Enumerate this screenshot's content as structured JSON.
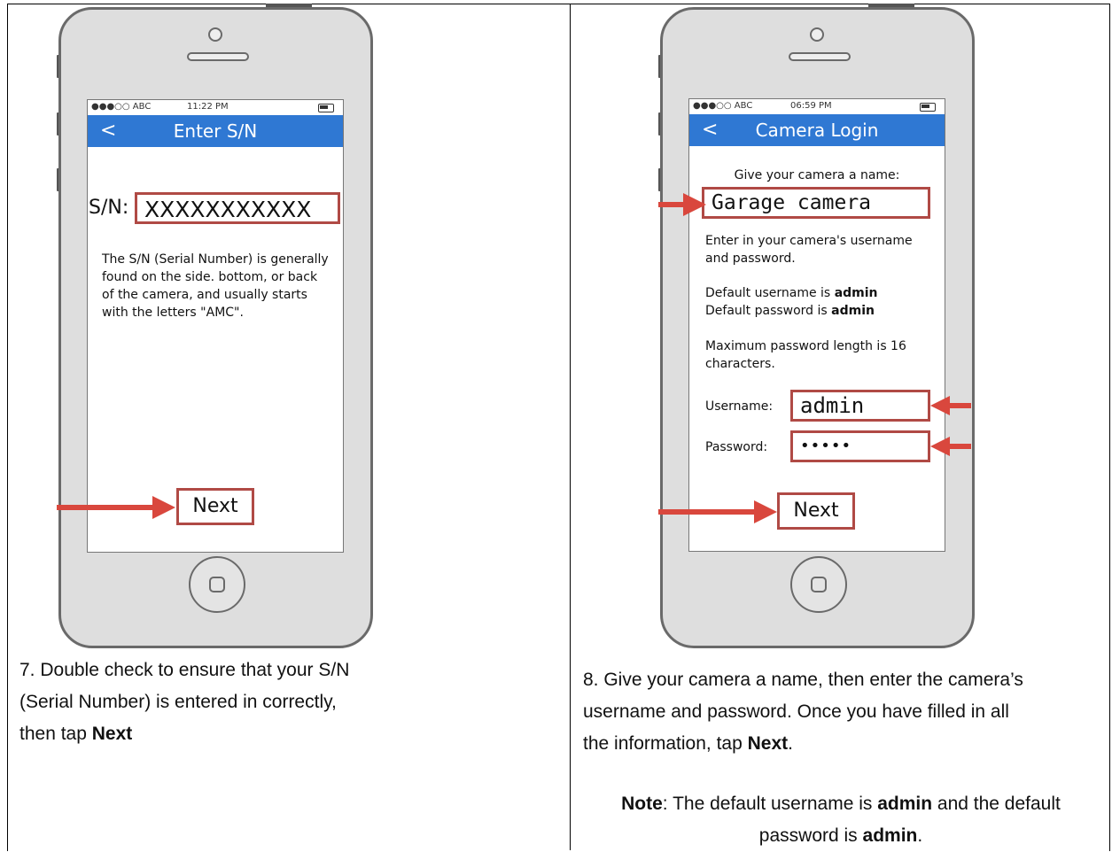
{
  "left": {
    "status": {
      "carrier": "●●●○○ ABC",
      "time": "11:22 PM"
    },
    "nav": {
      "back": "<",
      "title": "Enter S/N"
    },
    "sn_label": "S/N:",
    "sn_value": "XXXXXXXXXXX",
    "description": "The S/N (Serial Number) is generally found on the side. bottom, or back of the camera, and usually starts with the letters \"AMC\".",
    "next_label": "Next",
    "caption": {
      "line1": "7. Double check to ensure that your S/N",
      "line2": "(Serial Number) is entered in correctly,",
      "line3_pre": "then tap ",
      "line3_bold": "Next"
    }
  },
  "right": {
    "status": {
      "carrier": "●●●○○ ABC",
      "time": "06:59 PM"
    },
    "nav": {
      "back": "<",
      "title": "Camera Login"
    },
    "name_prompt": "Give your camera a name:",
    "name_value": "Garage camera",
    "enter_text": "Enter in your camera's username and password.",
    "default_user_pre": "Default username is ",
    "default_user_bold": "admin",
    "default_pass_pre": "Default password is ",
    "default_pass_bold": "admin",
    "max_text": "Maximum password length is 16 characters.",
    "username_label": "Username:",
    "username_value": "admin",
    "password_label": "Password:",
    "password_value": "•••••",
    "next_label": "Next",
    "caption": {
      "line1": "8. Give your camera a name, then enter the camera’s",
      "line2": "username and password. Once you have filled in all",
      "line3_pre": "the information, tap ",
      "line3_bold": "Next",
      "line3_post": "."
    },
    "note": {
      "label": "Note",
      "text1": ": The default username is ",
      "bold1": "admin",
      "text2": " and the default",
      "text3": "password is ",
      "bold2": "admin",
      "text4": "."
    }
  }
}
